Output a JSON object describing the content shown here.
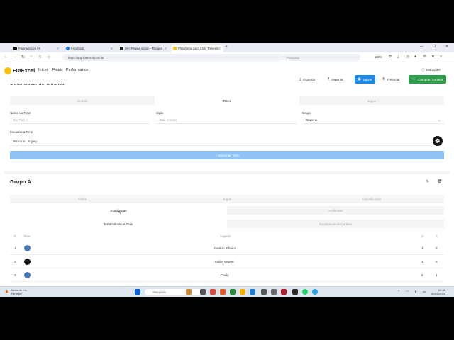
{
  "browser": {
    "tabs": [
      {
        "label": "Página inicial / X",
        "color": "#111111"
      },
      {
        "label": "Facebook",
        "color": "#1877f2"
      },
      {
        "label": "(9+) Página inicial • Threads",
        "color": "#222222"
      },
      {
        "label": "Plataforma para Criar Torneios",
        "color": "#f4c20d"
      }
    ],
    "url": "https://app.futexcel.com.br",
    "search_placeholder": "Pesquisar",
    "zoom": "100%"
  },
  "header": {
    "brand": "FutExcel",
    "nav": [
      "Início",
      "Finais",
      "Performance"
    ],
    "instructions": "Instruções"
  },
  "toolbar": {
    "export": "Exportar",
    "import": "Importar",
    "save": "Salvar",
    "restart": "Reiniciar",
    "buy": "Comprar Torneios"
  },
  "title_partial": "Gerenciador de Torneios",
  "top_tabs": [
    "Grupos",
    "Times",
    "Jogos"
  ],
  "form": {
    "team_name_label": "Nome do Time",
    "team_name_placeholder": "Ex: Time A",
    "abbr_label": "Sigla",
    "abbr_placeholder": "Máx. 3 letras",
    "group_label": "Grupo",
    "group_value": "Grupo A",
    "crest_label": "Escudo do Time",
    "crest_file": "Procurar...  0.jpeg",
    "add_button": "Adicionar Time"
  },
  "group": {
    "title": "Grupo A",
    "tabs": [
      "Times",
      "Jogos",
      "Classificação"
    ],
    "subtabs": [
      "Estatísticas",
      "Artilheiros"
    ],
    "subsubtabs": [
      "Estatísticas de Gols",
      "Estatísticas de Cartões"
    ],
    "columns": [
      "#",
      "Time",
      "Jogador",
      "G",
      "A"
    ],
    "rows": [
      {
        "pos": "1",
        "player": "Everton Ribeiro",
        "g": "1",
        "a": "0",
        "crest": "#4a79b8"
      },
      {
        "pos": "2",
        "player": "Pablo Vegetti",
        "g": "1",
        "a": "0",
        "crest": "#111111"
      },
      {
        "pos": "3",
        "player": "Cauly",
        "g": "0",
        "a": "1",
        "crest": "#4a79b8"
      }
    ]
  },
  "taskbar": {
    "weather_line1": "Alerta de frio",
    "weather_line2": "Em vigor",
    "search": "Pesquisar",
    "time": "09:55",
    "date": "30/01/2025"
  }
}
